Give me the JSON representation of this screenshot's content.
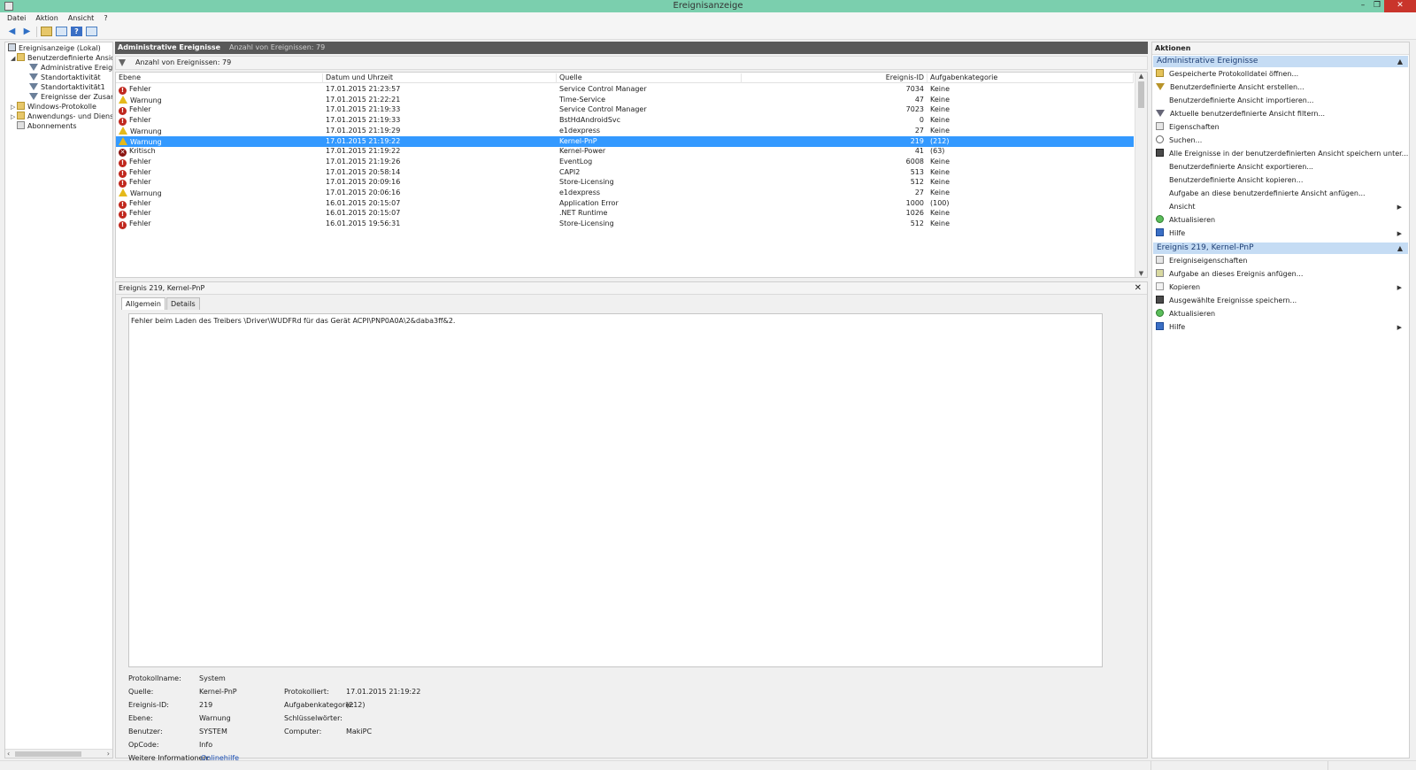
{
  "window": {
    "title": "Ereignisanzeige",
    "minimize": "–",
    "restore": "❐",
    "close": "✕"
  },
  "menu": [
    "Datei",
    "Aktion",
    "Ansicht",
    "?"
  ],
  "tree": {
    "root": "Ereignisanzeige (Lokal)",
    "custom_views": "Benutzerdefinierte Ansichten",
    "custom_children": [
      "Administrative Ereignisse",
      "Standortaktivität",
      "Standortaktivität1",
      "Ereignisse der Zusammenfassung"
    ],
    "windows_logs": "Windows-Protokolle",
    "app_logs": "Anwendungs- und Dienstprotokolle",
    "subscriptions": "Abonnements"
  },
  "center": {
    "header_title": "Administrative Ereignisse",
    "header_count": "Anzahl von Ereignissen: 79",
    "filter_text": "Anzahl von Ereignissen: 79"
  },
  "grid": {
    "columns": [
      "Ebene",
      "Datum und Uhrzeit",
      "Quelle",
      "Ereignis-ID",
      "Aufgabenkategorie"
    ],
    "rows": [
      {
        "sev": "err",
        "level": "Fehler",
        "date": "17.01.2015 21:23:57",
        "source": "Service Control Manager",
        "id": "7034",
        "cat": "Keine"
      },
      {
        "sev": "warn",
        "level": "Warnung",
        "date": "17.01.2015 21:22:21",
        "source": "Time-Service",
        "id": "47",
        "cat": "Keine"
      },
      {
        "sev": "err",
        "level": "Fehler",
        "date": "17.01.2015 21:19:33",
        "source": "Service Control Manager",
        "id": "7023",
        "cat": "Keine"
      },
      {
        "sev": "err",
        "level": "Fehler",
        "date": "17.01.2015 21:19:33",
        "source": "BstHdAndroidSvc",
        "id": "0",
        "cat": "Keine"
      },
      {
        "sev": "warn",
        "level": "Warnung",
        "date": "17.01.2015 21:19:29",
        "source": "e1dexpress",
        "id": "27",
        "cat": "Keine"
      },
      {
        "sev": "warn",
        "level": "Warnung",
        "date": "17.01.2015 21:19:22",
        "source": "Kernel-PnP",
        "id": "219",
        "cat": "(212)",
        "selected": true
      },
      {
        "sev": "crit",
        "level": "Kritisch",
        "date": "17.01.2015 21:19:22",
        "source": "Kernel-Power",
        "id": "41",
        "cat": "(63)"
      },
      {
        "sev": "err",
        "level": "Fehler",
        "date": "17.01.2015 21:19:26",
        "source": "EventLog",
        "id": "6008",
        "cat": "Keine"
      },
      {
        "sev": "err",
        "level": "Fehler",
        "date": "17.01.2015 20:58:14",
        "source": "CAPI2",
        "id": "513",
        "cat": "Keine"
      },
      {
        "sev": "err",
        "level": "Fehler",
        "date": "17.01.2015 20:09:16",
        "source": "Store-Licensing",
        "id": "512",
        "cat": "Keine"
      },
      {
        "sev": "warn",
        "level": "Warnung",
        "date": "17.01.2015 20:06:16",
        "source": "e1dexpress",
        "id": "27",
        "cat": "Keine"
      },
      {
        "sev": "err",
        "level": "Fehler",
        "date": "16.01.2015 20:15:07",
        "source": "Application Error",
        "id": "1000",
        "cat": "(100)"
      },
      {
        "sev": "err",
        "level": "Fehler",
        "date": "16.01.2015 20:15:07",
        "source": ".NET Runtime",
        "id": "1026",
        "cat": "Keine"
      },
      {
        "sev": "err",
        "level": "Fehler",
        "date": "16.01.2015 19:56:31",
        "source": "Store-Licensing",
        "id": "512",
        "cat": "Keine"
      }
    ]
  },
  "detail": {
    "title": "Ereignis 219, Kernel-PnP",
    "close": "✕",
    "tabs": [
      "Allgemein",
      "Details"
    ],
    "message": "Fehler beim Laden des Treibers \\Driver\\WUDFRd für das Gerät ACPI\\PNP0A0A\\2&daba3ff&2.",
    "props": {
      "log_label": "Protokollname:",
      "log_value": "System",
      "source_label": "Quelle:",
      "source_value": "Kernel-PnP",
      "logged_label": "Protokolliert:",
      "logged_value": "17.01.2015 21:19:22",
      "id_label": "Ereignis-ID:",
      "id_value": "219",
      "task_label": "Aufgabenkategorie:",
      "task_value": "(212)",
      "level_label": "Ebene:",
      "level_value": "Warnung",
      "keywords_label": "Schlüsselwörter:",
      "user_label": "Benutzer:",
      "user_value": "SYSTEM",
      "computer_label": "Computer:",
      "computer_value": "MakiPC",
      "opcode_label": "OpCode:",
      "opcode_value": "Info",
      "more_label": "Weitere Informationen:",
      "more_link": "Onlinehilfe"
    }
  },
  "actions": {
    "title": "Aktionen",
    "section1": "Administrative Ereignisse",
    "items1": [
      {
        "label": "Gespeicherte Protokolldatei öffnen...",
        "icon": "open"
      },
      {
        "label": "Benutzerdefinierte Ansicht erstellen...",
        "icon": "filt"
      },
      {
        "label": "Benutzerdefinierte Ansicht importieren...",
        "icon": "none"
      },
      {
        "label": "Aktuelle benutzerdefinierte Ansicht filtern...",
        "icon": "filt2"
      },
      {
        "label": "Eigenschaften",
        "icon": "prop"
      },
      {
        "label": "Suchen...",
        "icon": "find"
      },
      {
        "label": "Alle Ereignisse in der benutzerdefinierten Ansicht speichern unter...",
        "icon": "save"
      },
      {
        "label": "Benutzerdefinierte Ansicht exportieren...",
        "icon": "none"
      },
      {
        "label": "Benutzerdefinierte Ansicht kopieren...",
        "icon": "none"
      },
      {
        "label": "Aufgabe an diese benutzerdefinierte Ansicht anfügen...",
        "icon": "none"
      },
      {
        "label": "Ansicht",
        "icon": "none",
        "sub": true
      },
      {
        "label": "Aktualisieren",
        "icon": "refresh"
      },
      {
        "label": "Hilfe",
        "icon": "help",
        "sub": true
      }
    ],
    "section2": "Ereignis 219, Kernel-PnP",
    "items2": [
      {
        "label": "Ereigniseigenschaften",
        "icon": "prop"
      },
      {
        "label": "Aufgabe an dieses Ereignis anfügen...",
        "icon": "task"
      },
      {
        "label": "Kopieren",
        "icon": "copy",
        "sub": true
      },
      {
        "label": "Ausgewählte Ereignisse speichern...",
        "icon": "save"
      },
      {
        "label": "Aktualisieren",
        "icon": "refresh"
      },
      {
        "label": "Hilfe",
        "icon": "help",
        "sub": true
      }
    ]
  }
}
